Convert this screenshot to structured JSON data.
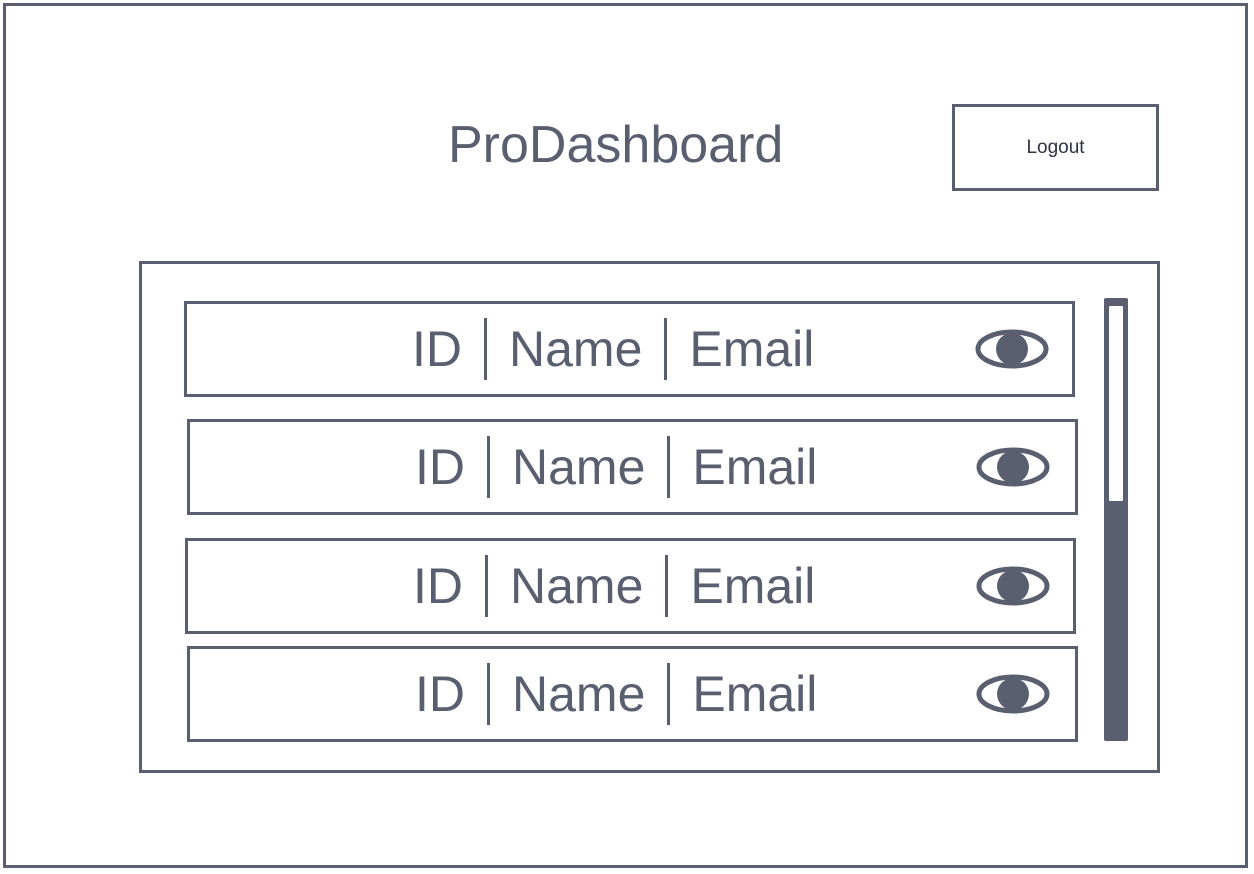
{
  "header": {
    "title": "ProDashboard",
    "logout_label": "Logout"
  },
  "table": {
    "rows": [
      {
        "id": "ID",
        "name": "Name",
        "email": "Email",
        "action_icon": "eye-icon"
      },
      {
        "id": "ID",
        "name": "Name",
        "email": "Email",
        "action_icon": "eye-icon"
      },
      {
        "id": "ID",
        "name": "Name",
        "email": "Email",
        "action_icon": "eye-icon"
      },
      {
        "id": "ID",
        "name": "Name",
        "email": "Email",
        "action_icon": "eye-icon"
      }
    ]
  },
  "colors": {
    "stroke": "#5a5f70",
    "background": "#ffffff"
  }
}
